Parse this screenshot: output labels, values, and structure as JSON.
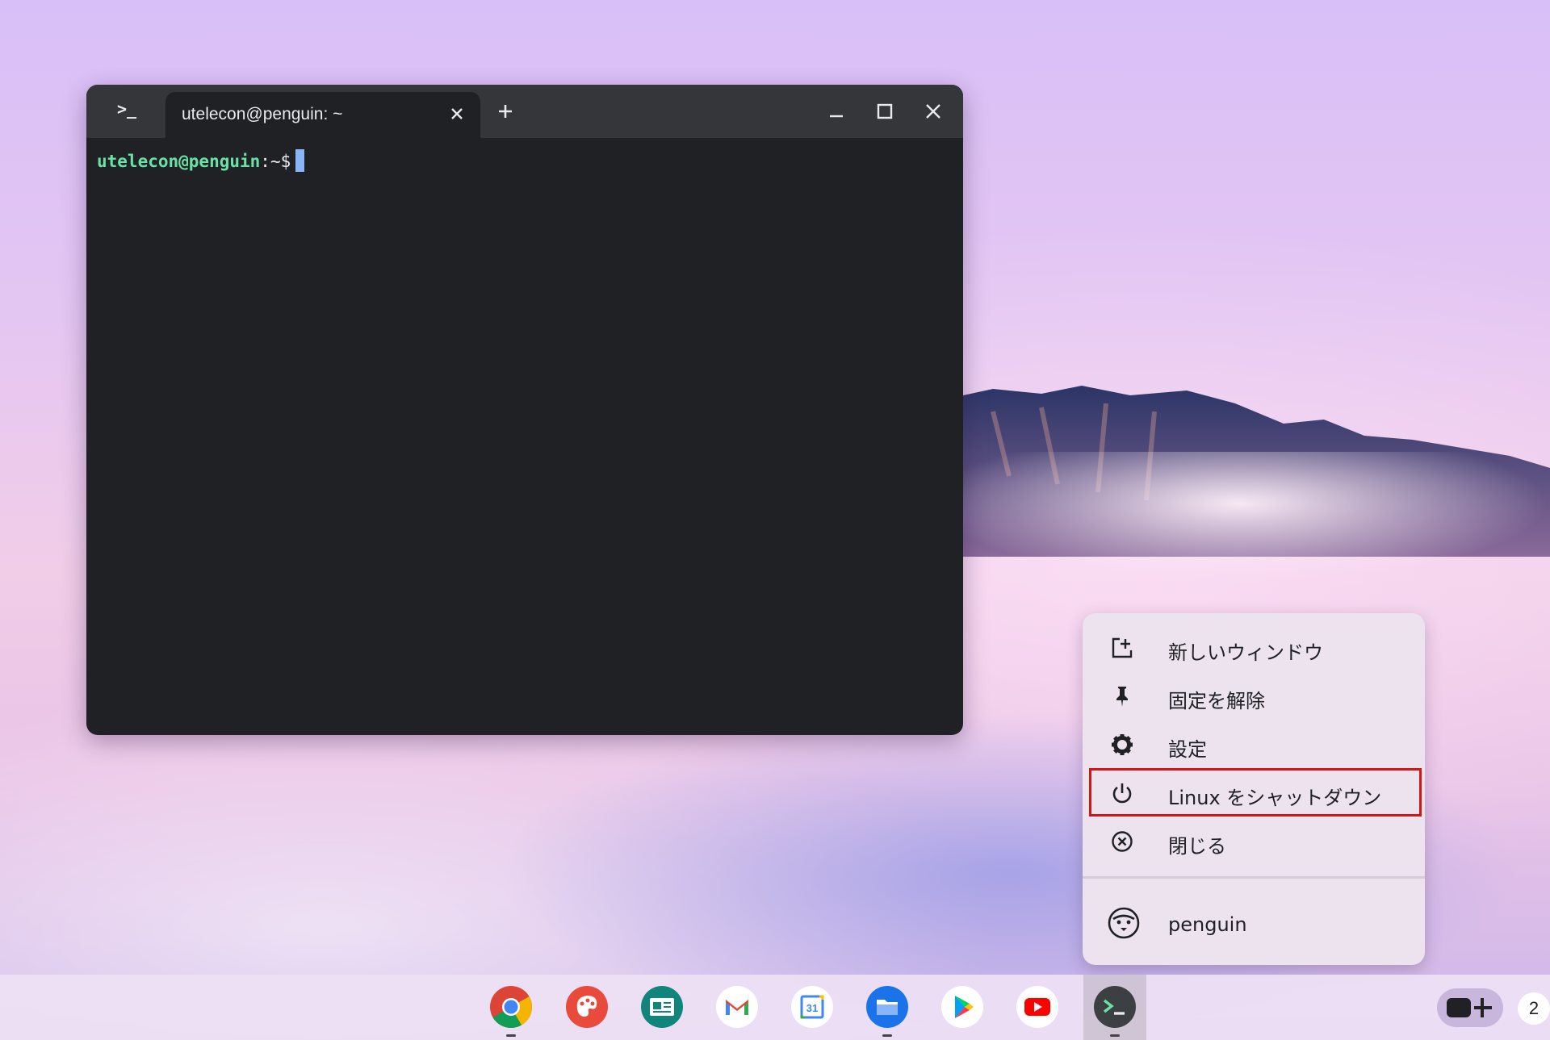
{
  "terminal": {
    "app_icon": ">_",
    "tab_title": "utelecon@penguin: ~",
    "prompt_user": "utelecon@penguin",
    "prompt_path": ":~$"
  },
  "context_menu": {
    "items": [
      {
        "label": "新しいウィンドウ",
        "icon": "new-window-icon"
      },
      {
        "label": "固定を解除",
        "icon": "unpin-icon"
      },
      {
        "label": "設定",
        "icon": "gear-icon"
      },
      {
        "label": "Linux をシャットダウン",
        "icon": "power-icon",
        "highlighted": true
      },
      {
        "label": "閉じる",
        "icon": "close-circle-icon"
      }
    ],
    "container": {
      "label": "penguin",
      "icon": "penguin-icon"
    }
  },
  "shelf": {
    "apps": [
      {
        "name": "chrome",
        "running": true
      },
      {
        "name": "canvas",
        "running": false
      },
      {
        "name": "news",
        "running": false
      },
      {
        "name": "gmail",
        "running": false
      },
      {
        "name": "calendar",
        "label": "31",
        "running": false
      },
      {
        "name": "files",
        "running": true
      },
      {
        "name": "play-store",
        "running": false
      },
      {
        "name": "youtube",
        "running": false
      },
      {
        "name": "terminal",
        "running": true
      }
    ],
    "tray_badge": "2"
  },
  "colors": {
    "highlight_border": "#d01616",
    "prompt_user": "#69e3a5",
    "cursor": "#8ab4f8"
  }
}
